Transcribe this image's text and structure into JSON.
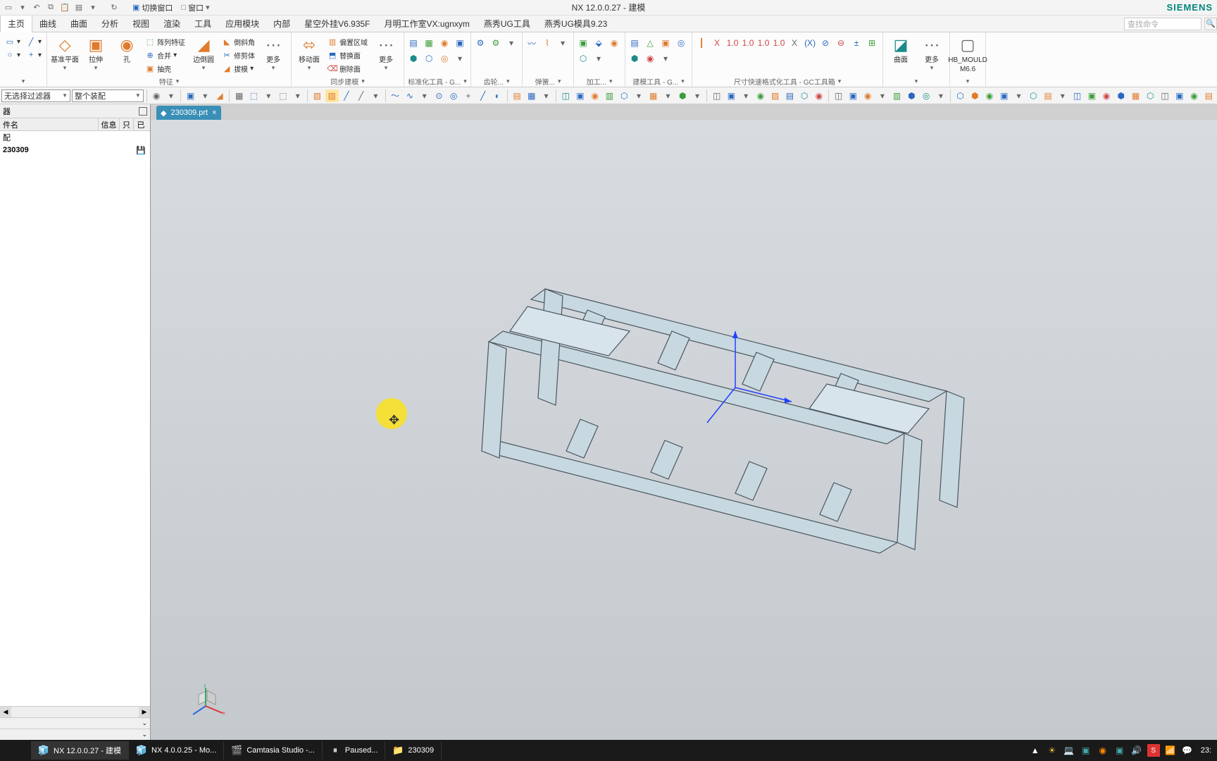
{
  "title": "NX 12.0.0.27 - 建模",
  "brand": "SIEMENS",
  "qat": {
    "switch_window": "切换窗口",
    "window": "窗口"
  },
  "menu": [
    "主页",
    "曲线",
    "曲面",
    "分析",
    "视图",
    "渲染",
    "工具",
    "应用模块",
    "内部",
    "星空外挂V6.935F",
    "月明工作室VX:ugnxym",
    "燕秀UG工具",
    "燕秀UG模具9.23"
  ],
  "search_placeholder": "查找命令",
  "ribbon": {
    "sketch": {
      "items": []
    },
    "feature": {
      "label": "特征",
      "datum": "基准平面",
      "extrude": "拉伸",
      "hole": "孔",
      "pattern": "阵列特征",
      "unite": "合并",
      "shell": "抽壳",
      "chamfer": "倒斜角",
      "trim": "修剪体",
      "draft": "拔模",
      "edge_blend": "边倒圆",
      "more": "更多"
    },
    "sync": {
      "label": "同步建模",
      "move_face": "移动面",
      "offset_region": "偏置区域",
      "replace_face": "替换面",
      "delete_face": "删除面",
      "more": "更多"
    },
    "std": {
      "label": "标准化工具 - G..."
    },
    "gear": {
      "label": "齿轮... "
    },
    "spring": {
      "label": "弹簧... "
    },
    "mfg": {
      "label": "加工... "
    },
    "model": {
      "label": "建模工具 - G..."
    },
    "dim": {
      "label": "尺寸快速格式化工具 - GC工具箱"
    },
    "surface": {
      "label": "",
      "curved": "曲面",
      "more": "更多"
    },
    "mould": {
      "label": "",
      "hb": "HB_MOULD",
      "ver": "M6.6"
    }
  },
  "filter": {
    "no_sel": "无选择过滤器",
    "whole_asm": "整个装配"
  },
  "left": {
    "header": "器",
    "col_name": "件名",
    "col_info": "信息",
    "col_r": "只",
    "col_g": "已",
    "rows": [
      {
        "name": "配",
        "info": "",
        "r": "",
        "g": ""
      },
      {
        "name": "230309",
        "info": "",
        "r": "",
        "g": "💾"
      }
    ]
  },
  "tab": {
    "name": "230309.prt"
  },
  "taskbar": {
    "items": [
      {
        "icon": "🧊",
        "label": "NX 12.0.0.27 - 建模"
      },
      {
        "icon": "🧊",
        "label": "NX 4.0.0.25 - Mo..."
      },
      {
        "icon": "🎬",
        "label": "Camtasia Studio -..."
      },
      {
        "icon": "⏸",
        "label": "Paused..."
      },
      {
        "icon": "📁",
        "label": "230309"
      }
    ],
    "clock": "23:"
  }
}
